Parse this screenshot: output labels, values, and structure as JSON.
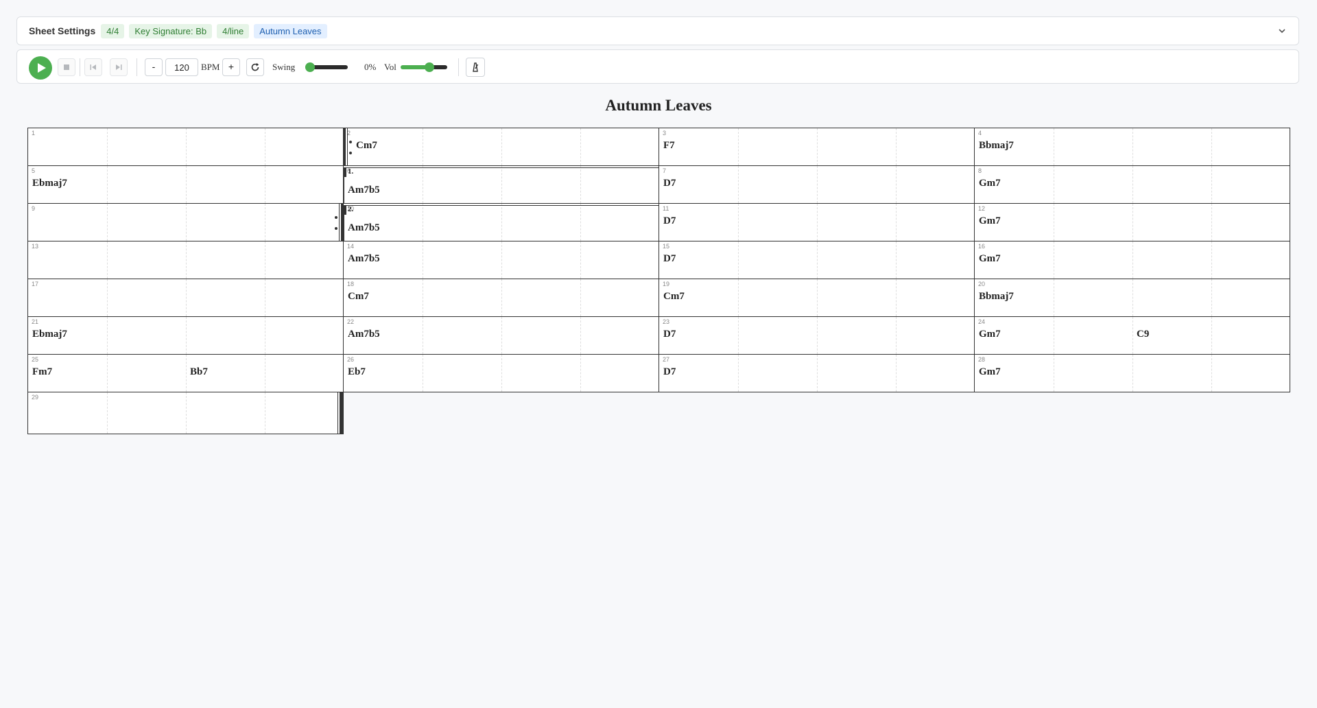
{
  "settings": {
    "title": "Sheet Settings",
    "badges": [
      "4/4",
      "Key Signature: Bb",
      "4/line",
      "Autumn Leaves"
    ],
    "chevron_icon": "chevron-down-icon"
  },
  "transport": {
    "bpm": "120",
    "bpm_label": "BPM",
    "minus_label": "-",
    "plus_label": "+",
    "swing_label": "Swing",
    "swing_value": "0%",
    "swing_level": 0,
    "vol_label": "Vol",
    "vol_level": 0.65,
    "accent_color": "#4caf50",
    "icons": [
      "play-icon",
      "stop-icon",
      "skip-back-icon",
      "skip-forward-icon",
      "loop-icon",
      "metronome-icon"
    ]
  },
  "sheet": {
    "title": "Autumn Leaves",
    "measures": [
      {
        "num": "1",
        "chords": []
      },
      {
        "num": "2",
        "chords": [
          {
            "beat": 1,
            "label": "Cm7"
          }
        ]
      },
      {
        "num": "3",
        "chords": [
          {
            "beat": 1,
            "label": "F7"
          }
        ]
      },
      {
        "num": "4",
        "chords": [
          {
            "beat": 1,
            "label": "Bbmaj7"
          }
        ]
      },
      {
        "num": "5",
        "chords": [
          {
            "beat": 1,
            "label": "Ebmaj7"
          }
        ]
      },
      {
        "num": "6",
        "chords": [
          {
            "beat": 1,
            "label": "Am7b5"
          }
        ]
      },
      {
        "num": "7",
        "chords": [
          {
            "beat": 1,
            "label": "D7"
          }
        ]
      },
      {
        "num": "8",
        "chords": [
          {
            "beat": 1,
            "label": "Gm7"
          }
        ]
      },
      {
        "num": "9",
        "chords": []
      },
      {
        "num": "10",
        "chords": [
          {
            "beat": 1,
            "label": "Am7b5"
          }
        ]
      },
      {
        "num": "11",
        "chords": [
          {
            "beat": 1,
            "label": "D7"
          }
        ]
      },
      {
        "num": "12",
        "chords": [
          {
            "beat": 1,
            "label": "Gm7"
          }
        ]
      },
      {
        "num": "13",
        "chords": []
      },
      {
        "num": "14",
        "chords": [
          {
            "beat": 1,
            "label": "Am7b5"
          }
        ]
      },
      {
        "num": "15",
        "chords": [
          {
            "beat": 1,
            "label": "D7"
          }
        ]
      },
      {
        "num": "16",
        "chords": [
          {
            "beat": 1,
            "label": "Gm7"
          }
        ]
      },
      {
        "num": "17",
        "chords": []
      },
      {
        "num": "18",
        "chords": [
          {
            "beat": 1,
            "label": "Cm7"
          }
        ]
      },
      {
        "num": "19",
        "chords": [
          {
            "beat": 1,
            "label": "Cm7"
          }
        ]
      },
      {
        "num": "20",
        "chords": [
          {
            "beat": 1,
            "label": "Bbmaj7"
          }
        ]
      },
      {
        "num": "21",
        "chords": [
          {
            "beat": 1,
            "label": "Ebmaj7"
          }
        ]
      },
      {
        "num": "22",
        "chords": [
          {
            "beat": 1,
            "label": "Am7b5"
          }
        ]
      },
      {
        "num": "23",
        "chords": [
          {
            "beat": 1,
            "label": "D7"
          }
        ]
      },
      {
        "num": "24",
        "chords": [
          {
            "beat": 1,
            "label": "Gm7"
          },
          {
            "beat": 3,
            "label": "C9"
          }
        ]
      },
      {
        "num": "25",
        "chords": [
          {
            "beat": 1,
            "label": "Fm7"
          },
          {
            "beat": 3,
            "label": "Bb7"
          }
        ]
      },
      {
        "num": "26",
        "chords": [
          {
            "beat": 1,
            "label": "Eb7"
          }
        ]
      },
      {
        "num": "27",
        "chords": [
          {
            "beat": 1,
            "label": "D7"
          }
        ]
      },
      {
        "num": "28",
        "chords": [
          {
            "beat": 1,
            "label": "Gm7"
          }
        ]
      },
      {
        "num": "29",
        "chords": []
      }
    ],
    "endings": [
      {
        "measure": "6",
        "label": "1."
      },
      {
        "measure": "10",
        "label": "2."
      }
    ],
    "repeat_start_measure": "2",
    "repeat_end_measure": "9",
    "final_barline_measure": "29"
  }
}
